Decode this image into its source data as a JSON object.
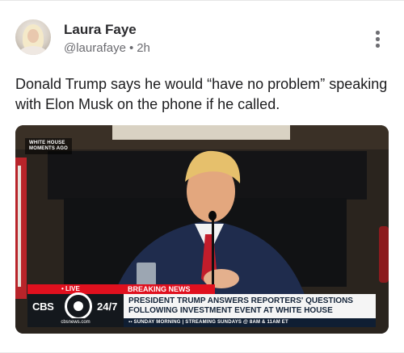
{
  "author": {
    "name": "Laura Faye",
    "handle": "@laurafaye",
    "separator": "•",
    "time": "2h"
  },
  "post": {
    "text": "Donald Trump says he would “have no problem” speaking with Elon Musk on the phone if he called."
  },
  "media": {
    "corner_bug": "WHITE HOUSE MOMENTS AGO",
    "live_label": "• LIVE",
    "breaking_label": "BREAKING NEWS",
    "network_left": "CBS",
    "network_right": "24/7",
    "headline": "PRESIDENT TRUMP ANSWERS REPORTERS' QUESTIONS FOLLOWING INVESTMENT EVENT AT WHITE HOUSE",
    "site": "cbsnews.com",
    "ticker": "▪▪ SUNDAY MORNING | STREAMING SUNDAYS @ 8AM & 11AM ET"
  },
  "icons": {
    "more": "more-vertical-icon",
    "avatar": "profile-avatar",
    "network_logo": "cbs-eye-icon"
  },
  "colors": {
    "breaking_red": "#e0101e",
    "ticker_navy": "#0f1e33"
  }
}
